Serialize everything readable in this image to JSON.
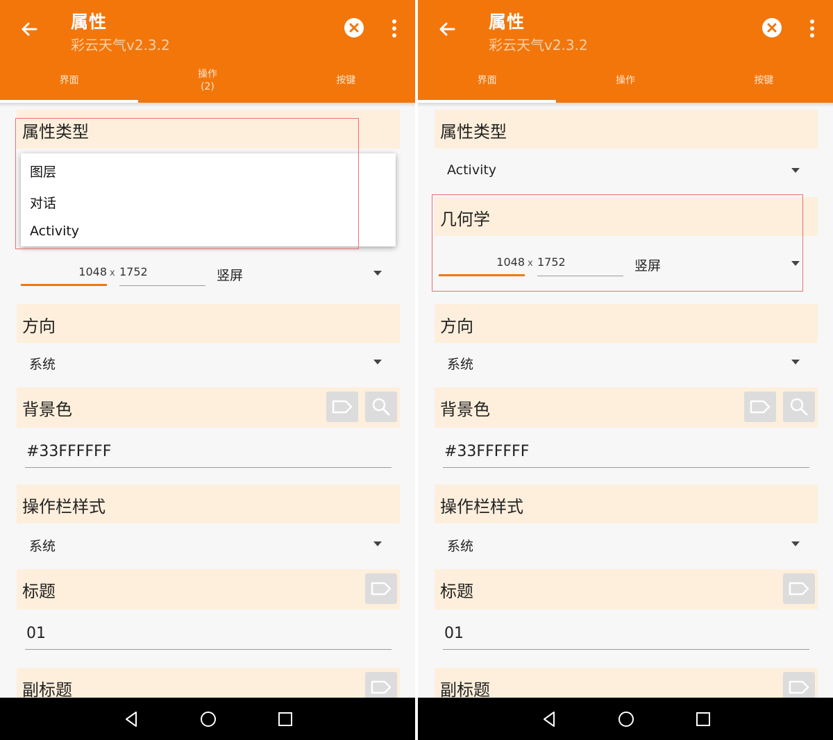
{
  "colors": {
    "accent": "#f3760b",
    "section_bg": "#fdefdc",
    "highlight": "#ef6d6d",
    "navbar": "#000000"
  },
  "left": {
    "title": "属性",
    "subtitle": "彩云天气v2.3.2",
    "tabs": [
      {
        "label": "界面",
        "badge": ""
      },
      {
        "label": "操作",
        "badge": "(2)"
      },
      {
        "label": "按键",
        "badge": ""
      }
    ],
    "sections": {
      "type": "属性类型",
      "geometry_width": "1048",
      "geometry_x": "x",
      "geometry_height": "1752",
      "geometry_orientation": "竖屏",
      "direction": "方向",
      "direction_value": "系统",
      "bgcolor": "背景色",
      "bgcolor_value": "#33FFFFFF",
      "actionbar": "操作栏样式",
      "actionbar_value": "系统",
      "title_label": "标题",
      "title_value": "01",
      "subtitle_label": "副标题"
    },
    "popup_items": [
      "图层",
      "对话",
      "Activity"
    ]
  },
  "right": {
    "title": "属性",
    "subtitle": "彩云天气v2.3.2",
    "tabs": [
      {
        "label": "界面",
        "badge": ""
      },
      {
        "label": "操作",
        "badge": ""
      },
      {
        "label": "按键",
        "badge": ""
      }
    ],
    "sections": {
      "type": "属性类型",
      "type_value": "Activity",
      "geometry": "几何学",
      "geometry_width": "1048",
      "geometry_x": "x",
      "geometry_height": "1752",
      "geometry_orientation": "竖屏",
      "direction": "方向",
      "direction_value": "系统",
      "bgcolor": "背景色",
      "bgcolor_value": "#33FFFFFF",
      "actionbar": "操作栏样式",
      "actionbar_value": "系统",
      "title_label": "标题",
      "title_value": "01",
      "subtitle_label": "副标题"
    }
  },
  "icons": [
    "back-arrow-icon",
    "close-circle-icon",
    "more-vert-icon",
    "label-tag-icon",
    "search-icon",
    "nav-back-icon",
    "nav-home-icon",
    "nav-recents-icon"
  ]
}
